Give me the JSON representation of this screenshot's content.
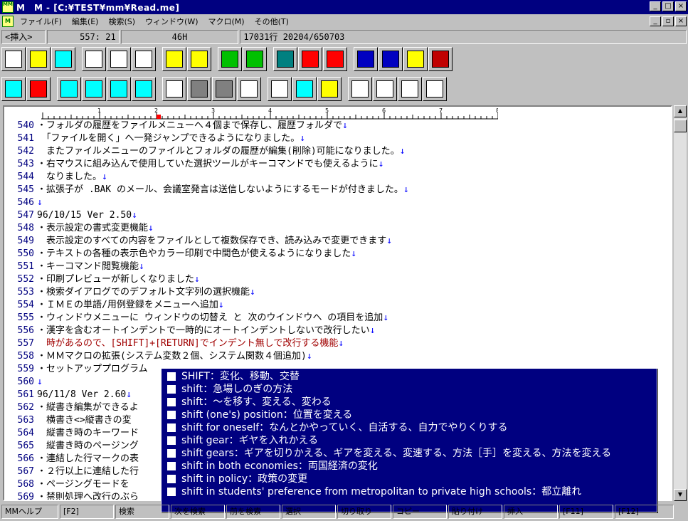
{
  "window": {
    "title": "M　M - [C:¥TEST¥mm¥Read.me]",
    "app_icon": "MM"
  },
  "menu": {
    "items": [
      "ファイル(F)",
      "編集(E)",
      "検索(S)",
      "ウィンドウ(W)",
      "マクロ(M)",
      "その他(T)"
    ]
  },
  "status": {
    "mode": "<挿入>",
    "position": "557: 21",
    "char_code": "46H",
    "line_info": "17031行 20204/650703"
  },
  "toolbar1_icons": [
    "new-file-icon",
    "open-folder-icon",
    "save-icon",
    "print-icon",
    "print-preview-icon",
    "print-setup-icon",
    "search-forward-icon",
    "search-backward-icon",
    "undo-icon",
    "redo-icon",
    "book-icon",
    "find-next-down-icon",
    "find-next-up-icon",
    "calculator-icon",
    "calendar-icon",
    "telephone-icon",
    "dictionary-icon"
  ],
  "toolbar2_icons": [
    "swap-icon",
    "grep-icon",
    "split-vertical-icon",
    "split-horizontal-icon",
    "cascade-icon",
    "tile-icon",
    "memo-icon",
    "mark-cursor-icon",
    "mark-keyboard-icon",
    "draw-icon",
    "table-icon",
    "kanji-icon",
    "convert-icon",
    "mail-icon",
    "eye-chart-icon",
    "display-icon",
    "end-icon"
  ],
  "ruler": {
    "labels": [
      "1",
      "2",
      "3",
      "4",
      "5",
      "6",
      "7",
      "8"
    ]
  },
  "editor": {
    "lines": [
      {
        "no": "540",
        "text": "・フォルダの履歴をファイルメニューへ４個まで保存し、履歴フォルダで",
        "mark": "↓"
      },
      {
        "no": "541",
        "text": "　「ファイルを開く」へ一発ジャンプできるようになりました。",
        "mark": "↓"
      },
      {
        "no": "542",
        "text": "　またファイルメニューのファイルとフォルダの履歴が編集(削除)可能になりました。",
        "mark": "↓"
      },
      {
        "no": "543",
        "text": "・右マウスに組み込んで使用していた選択ツールがキーコマンドでも使えるように",
        "mark": "↓"
      },
      {
        "no": "544",
        "text": "　なりました。",
        "mark": "↓"
      },
      {
        "no": "545",
        "text": "・拡張子が .BAK のメール、会議室発言は送信しないようにするモードが付きました。",
        "mark": "↓"
      },
      {
        "no": "546",
        "text": "",
        "mark": "↓"
      },
      {
        "no": "547",
        "text": "96/10/15 Ver 2.50",
        "mark": "↓"
      },
      {
        "no": "548",
        "text": "・表示設定の書式変更機能",
        "mark": "↓"
      },
      {
        "no": "549",
        "text": "　表示設定のすべての内容をファイルとして複数保存でき、読み込みで変更できます",
        "mark": "↓"
      },
      {
        "no": "550",
        "text": "・テキストの各種の表示色やカラー印刷で中間色が使えるようになりました",
        "mark": "↓"
      },
      {
        "no": "551",
        "text": "・キーコマンド閲覧機能",
        "mark": "↓"
      },
      {
        "no": "552",
        "text": "・印刷プレビューが新しくなりました",
        "mark": "↓"
      },
      {
        "no": "553",
        "text": "・検索ダイアログでのデフォルト文字列の選択機能",
        "mark": "↓"
      },
      {
        "no": "554",
        "text": "・ＩＭＥの単語/用例登録をメニューへ追加",
        "mark": "↓"
      },
      {
        "no": "555",
        "text": "・ウィンドウメニューに ウィンドウの切替え と 次のウインドウへ の項目を追加",
        "mark": "↓"
      },
      {
        "no": "556",
        "text": "・漢字を含むオートインデントで一時的にオートインデントしないで改行したい",
        "mark": "↓"
      },
      {
        "no": "557",
        "text": "　時があるので、[SHIFT]+[RETURN]でインデント無しで改行する機能",
        "mark": "↓",
        "red": true
      },
      {
        "no": "558",
        "text": "・ＭＭマクロの拡張(システム変数２個、システム関数４個追加)",
        "mark": "↓"
      },
      {
        "no": "559",
        "text": "・セットアッププログラム",
        "mark": ""
      },
      {
        "no": "560",
        "text": "",
        "mark": "↓"
      },
      {
        "no": "561",
        "text": "96/11/8 Ver 2.60",
        "mark": "↓"
      },
      {
        "no": "562",
        "text": "・縦書き編集ができるよ",
        "mark": ""
      },
      {
        "no": "563",
        "text": "　横書き<>縦書きの変",
        "mark": ""
      },
      {
        "no": "564",
        "text": "　縦書き時のキーワード",
        "mark": ""
      },
      {
        "no": "565",
        "text": "　縦書き時のページング",
        "mark": ""
      },
      {
        "no": "566",
        "text": "・連結した行マークの表",
        "mark": ""
      },
      {
        "no": "567",
        "text": "・２行以上に連結した行",
        "mark": ""
      },
      {
        "no": "568",
        "text": "・ページングモードを",
        "mark": ""
      },
      {
        "no": "569",
        "text": "・禁則処理へ改行のぶら",
        "mark": ""
      }
    ]
  },
  "popup": {
    "items": [
      "SHIFT：変化、移動、交替",
      "shift：急場しのぎの方法",
      "shift：～を移す、変える、変わる",
      "shift (one's) position：位置を変える",
      "shift for oneself：なんとかやっていく、自活する、自力でやりくりする",
      "shift gear：ギヤを入れかえる",
      "shift gears：ギアを切りかえる、ギアを変える、変速する、方法［手］を変える、方法を変える",
      "shift in both economies：両国経済の変化",
      "shift in policy：政策の変更",
      "shift in students' preference from metropolitan to private high schools：都立離れ"
    ]
  },
  "fkeys": [
    "MMヘルプ",
    "[F2]",
    "検索",
    "次を検索",
    "前を検索",
    "選択",
    "切り取り",
    "コピー",
    "貼り付け",
    "挿入",
    "[F11]",
    "[F12]"
  ]
}
